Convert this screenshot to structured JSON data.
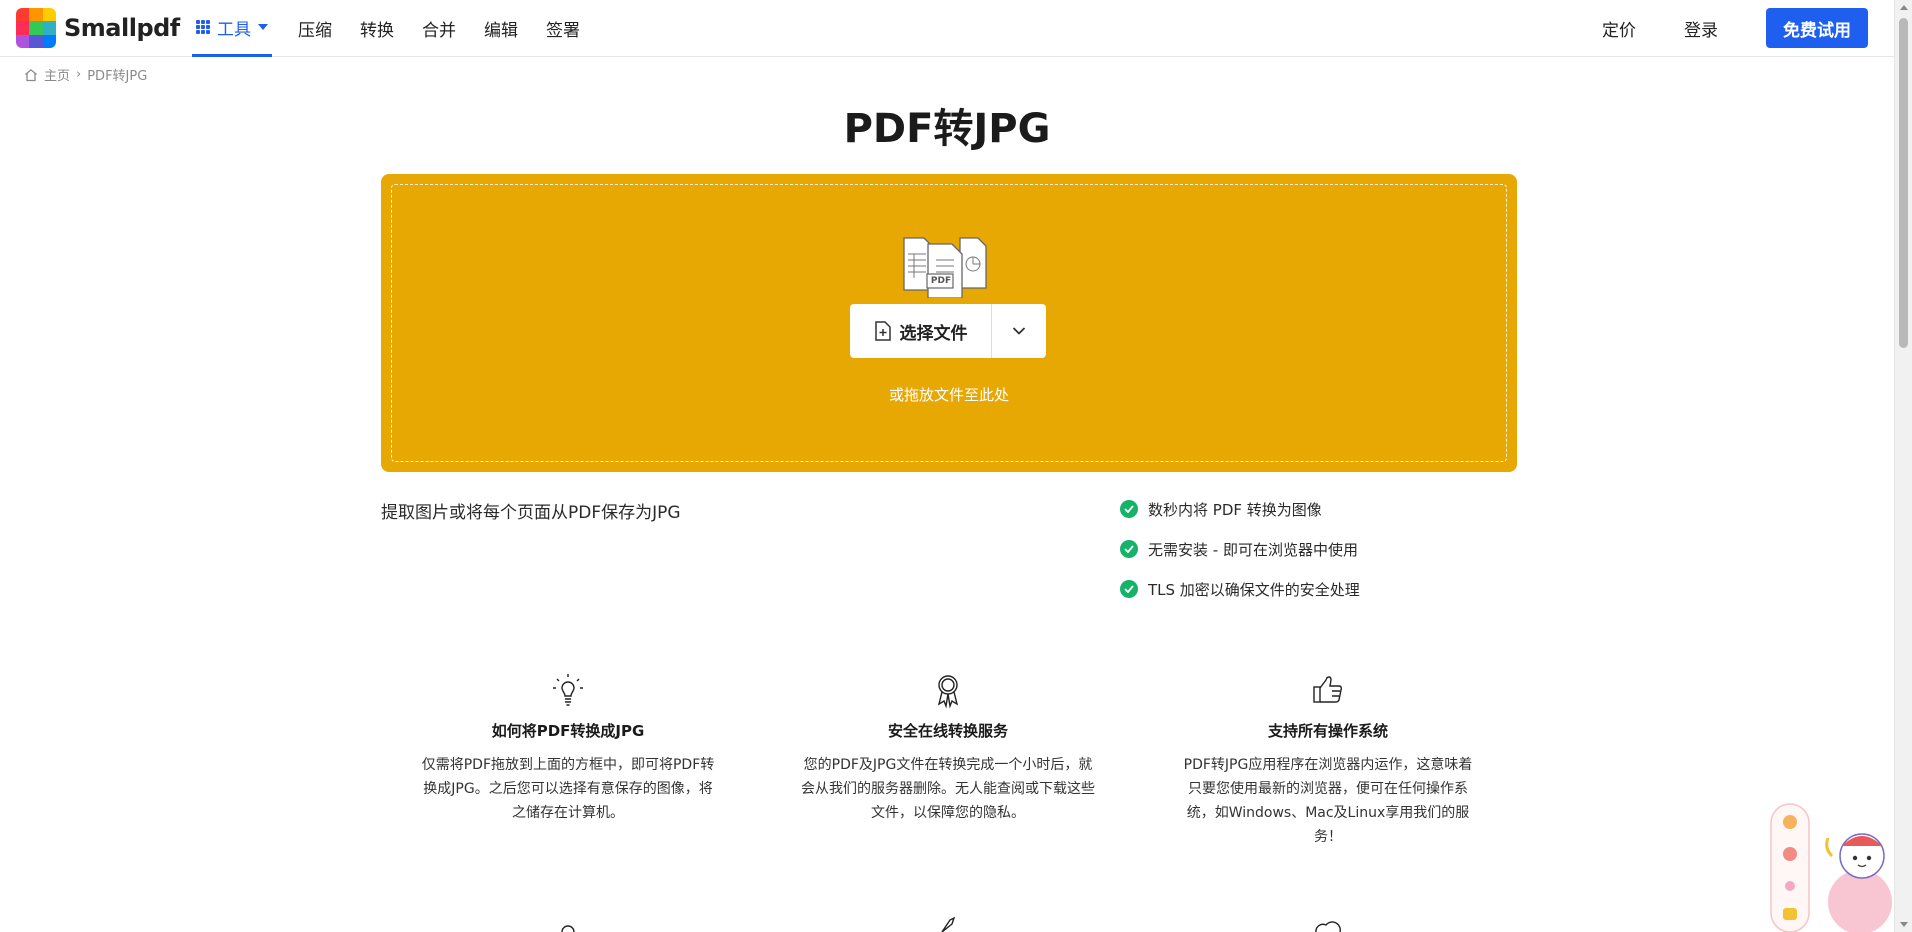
{
  "header": {
    "logo_text": "Smallpdf",
    "nav": {
      "tools_label": "工具",
      "items": [
        "压缩",
        "转换",
        "合并",
        "编辑",
        "签署"
      ]
    },
    "pricing_label": "定价",
    "login_label": "登录",
    "cta_label": "免费试用"
  },
  "breadcrumb": {
    "home": "主页",
    "current": "PDF转JPG"
  },
  "page_title": "PDF转JPG",
  "dropzone": {
    "select_label": "选择文件",
    "hint": "或拖放文件至此处",
    "badge": "PDF"
  },
  "subtitle": "提取图片或将每个页面从PDF保存为JPG",
  "features": [
    "数秒内将 PDF 转换为图像",
    "无需安装 - 即可在浏览器中使用",
    "TLS 加密以确保文件的安全处理"
  ],
  "cards": [
    {
      "icon": "lightbulb-icon",
      "title": "如何将PDF转换成JPG",
      "text": "仅需将PDF拖放到上面的方框中，即可将PDF转换成JPG。之后您可以选择有意保存的图像，将之储存在计算机。"
    },
    {
      "icon": "award-icon",
      "title": "安全在线转换服务",
      "text": "您的PDF及JPG文件在转换完成一个小时后，就会从我们的服务器删除。无人能查阅或下载这些文件，以保障您的隐私。"
    },
    {
      "icon": "thumbs-up-icon",
      "title": "支持所有操作系统",
      "text": "PDF转JPG应用程序在浏览器内运作，这意味着只要您使用最新的浏览器，便可在任何操作系统，如Windows、Mac及Linux享用我们的服务！"
    }
  ],
  "colors": {
    "brand_blue": "#1f5ff0",
    "dropzone_yellow": "#e8a804",
    "check_green": "#17b26a"
  }
}
